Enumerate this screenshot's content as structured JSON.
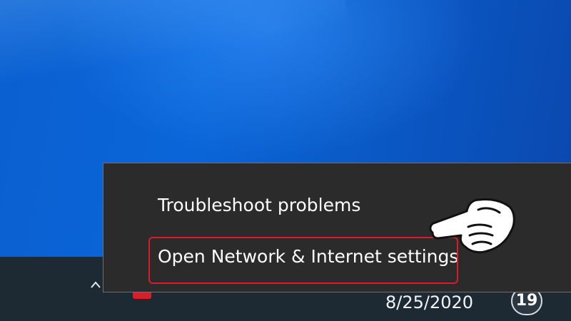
{
  "context_menu": {
    "items": [
      {
        "label": "Troubleshoot problems"
      },
      {
        "label": "Open Network & Internet settings"
      }
    ]
  },
  "taskbar": {
    "date": "8/25/2020",
    "notification_count": "19",
    "icons": [
      "chevron-up-icon",
      "red-app-icon",
      "hand-pointer-icon"
    ]
  },
  "colors": {
    "desktop_blue": "#0a66d8",
    "taskbar": "#1d2a33",
    "menu_background": "#2b2b2b",
    "highlight": "#e0192a"
  }
}
